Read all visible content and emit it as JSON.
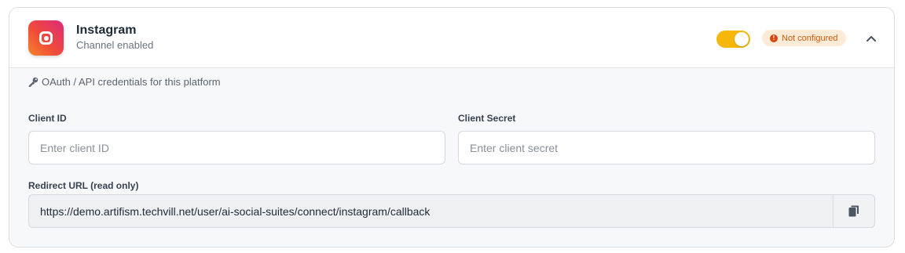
{
  "channel": {
    "name": "Instagram",
    "status_text": "Channel enabled",
    "icon": "instagram-icon",
    "enabled": true,
    "badge": {
      "label": "Not configured",
      "icon": "alert-circle-icon",
      "color": "#d15a0a"
    },
    "expanded": true
  },
  "credentials": {
    "note": "OAuth / API credentials for this platform",
    "note_icon": "key-icon",
    "client_id": {
      "label": "Client ID",
      "placeholder": "Enter client ID",
      "value": ""
    },
    "client_secret": {
      "label": "Client Secret",
      "placeholder": "Enter client secret",
      "value": ""
    },
    "redirect": {
      "label": "Redirect URL (read only)",
      "url": "https://demo.artifism.techvill.net/user/ai-social-suites/connect/instagram/callback",
      "copy_icon": "copy-icon"
    }
  },
  "colors": {
    "toggle_on": "#f5b80a",
    "badge_bg": "#fdebd8",
    "badge_text": "#d15a0a"
  }
}
